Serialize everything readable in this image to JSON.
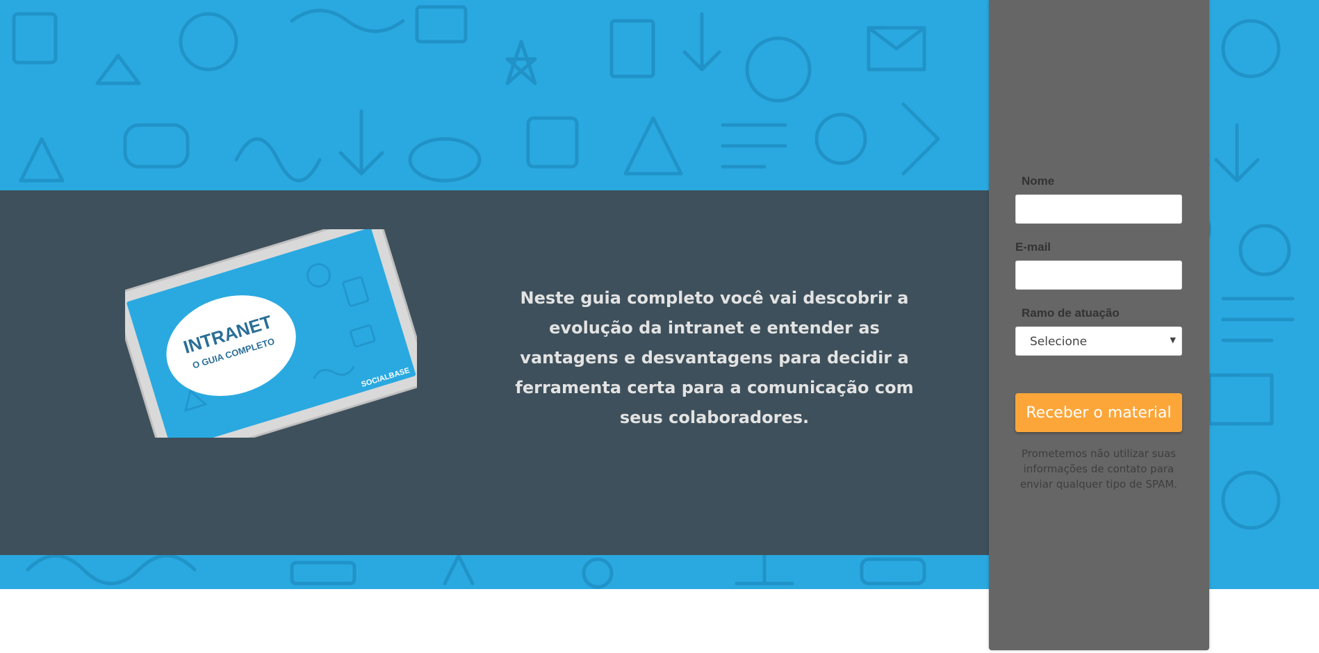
{
  "hero": {
    "description": "Neste guia completo você vai descobrir a evolução da intranet e entender as vantagens e desvantagens para decidir a ferramenta certa para a comunicação com seus colaboradores."
  },
  "ebook": {
    "title": "INTRANET",
    "subtitle": "O GUIA COMPLETO",
    "brand": "SOCIALBASE"
  },
  "form": {
    "name_label": "Nome",
    "email_label": "E-mail",
    "industry_label": "Ramo de atuação",
    "industry_selected": "Selecione",
    "submit_label": "Receber o material",
    "privacy_note": "Prometemos não utilizar suas informações de contato para enviar qualquer tipo de SPAM."
  },
  "colors": {
    "background_blue": "#2aa9e0",
    "band": "#404951",
    "sidebar": "#666666",
    "button": "#fca639"
  }
}
